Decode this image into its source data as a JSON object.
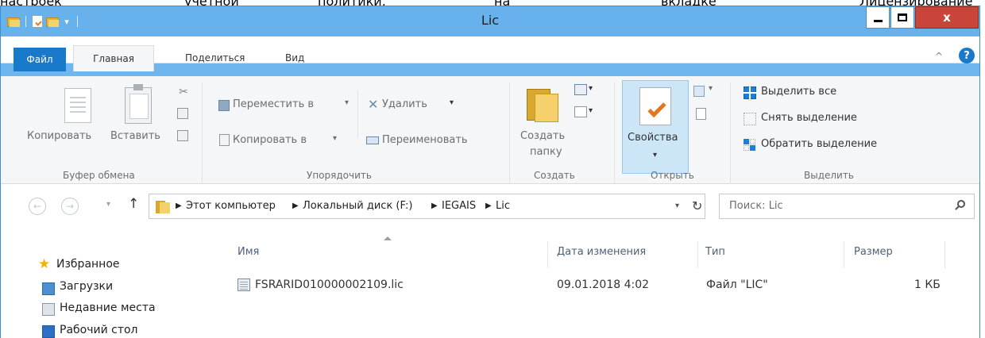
{
  "document_text": [
    "настроек",
    "учетной",
    "политики,",
    "на",
    "вкладке",
    "Лицензирование"
  ],
  "window": {
    "title": "Lic",
    "close_label": "x"
  },
  "ribbon_tabs": {
    "file": "Файл",
    "home": "Главная",
    "share": "Поделиться",
    "view": "Вид"
  },
  "clipboard": {
    "copy": "Копировать",
    "paste": "Вставить",
    "group": "Буфер обмена"
  },
  "organize": {
    "move": "Переместить в",
    "copy_to": "Копировать в",
    "delete": "Удалить",
    "rename": "Переименовать",
    "group": "Упорядочить"
  },
  "new": {
    "new_folder_line1": "Создать",
    "new_folder_line2": "папку",
    "group": "Создать"
  },
  "open": {
    "properties": "Свойства",
    "group": "Открыть"
  },
  "select": {
    "select_all": "Выделить все",
    "select_none": "Снять выделение",
    "invert": "Обратить выделение",
    "group": "Выделить"
  },
  "address": {
    "path": [
      "Этот компьютер",
      "Локальный диск (F:)",
      "IEGAIS",
      "Lic"
    ]
  },
  "search": {
    "placeholder": "Поиск: Lic"
  },
  "nav_pane": {
    "items": [
      "Избранное",
      "Загрузки",
      "Недавние места",
      "Рабочий стол"
    ]
  },
  "columns": {
    "name": "Имя",
    "date": "Дата изменения",
    "type": "Тип",
    "size": "Размер"
  },
  "files": [
    {
      "name": "FSRARID010000002109.lic",
      "date": "09.01.2018 4:02",
      "type": "Файл \"LIC\"",
      "size": "1 КБ"
    }
  ],
  "colors": {
    "titlebar": "#67b2ec",
    "file_tab": "#1979ca",
    "close_button": "#c9453a"
  }
}
